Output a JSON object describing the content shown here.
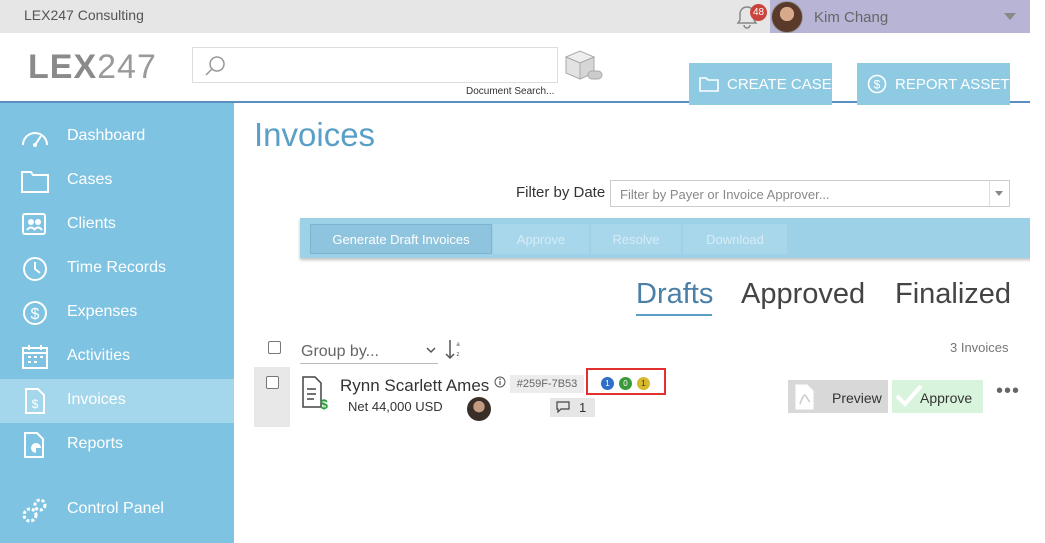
{
  "topbar": {
    "company": "LEX247 Consulting",
    "notification_count": "48",
    "user_name": "Kim Chang"
  },
  "header": {
    "logo_bold": "LEX",
    "logo_light": "247",
    "search_caption": "Document Search...",
    "create_case": "CREATE CASE",
    "report_asset": "REPORT ASSET"
  },
  "sidebar": {
    "items": [
      {
        "label": "Dashboard",
        "icon": "dashboard-icon"
      },
      {
        "label": "Cases",
        "icon": "folder-icon"
      },
      {
        "label": "Clients",
        "icon": "clients-icon"
      },
      {
        "label": "Time Records",
        "icon": "clock-icon"
      },
      {
        "label": "Expenses",
        "icon": "dollar-icon"
      },
      {
        "label": "Activities",
        "icon": "calendar-icon"
      },
      {
        "label": "Invoices",
        "icon": "invoice-icon"
      },
      {
        "label": "Reports",
        "icon": "report-icon"
      },
      {
        "label": "Control Panel",
        "icon": "gears-icon"
      }
    ],
    "active": "Invoices"
  },
  "main": {
    "title": "Invoices",
    "filter_label": "Filter by Date",
    "filter_placeholder": "Filter by Payer or Invoice Approver...",
    "toolbar": {
      "generate": "Generate Draft Invoices",
      "approve": "Approve",
      "resolve": "Resolve",
      "download": "Download"
    },
    "tabs": [
      "Drafts",
      "Approved",
      "Finalized"
    ],
    "active_tab": "Drafts",
    "group_by": "Group by...",
    "invoice_count": "3 Invoices",
    "invoice": {
      "client": "Rynn Scarlett Ames",
      "id": "#259F-7B53",
      "net": "Net 44,000 USD",
      "comments": "1",
      "status_counts": [
        "1",
        "0",
        "1"
      ],
      "preview": "Preview",
      "approve": "Approve"
    }
  },
  "colors": {
    "sidebar": "#7fc3e2",
    "accent": "#5a9fc7",
    "status_blue": "#2f6fc8",
    "status_green": "#3a9a3a",
    "status_yellow": "#d6b92c",
    "highlight": "#e03030"
  }
}
